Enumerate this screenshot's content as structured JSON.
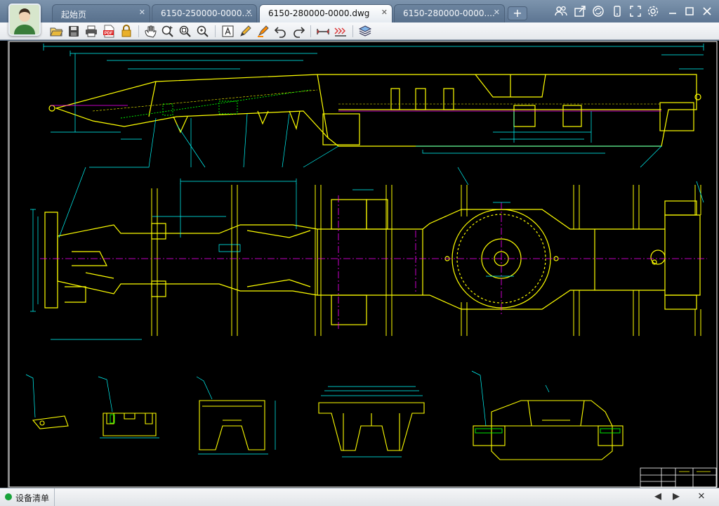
{
  "tabs": [
    {
      "label": "起始页",
      "active": false
    },
    {
      "label": "6150-250000-0000....",
      "active": false
    },
    {
      "label": "6150-280000-0000.dwg",
      "active": true
    },
    {
      "label": "6150-280000-0000....",
      "active": false
    }
  ],
  "new_tab_label": "+",
  "title_icons": [
    "users-icon",
    "share-icon",
    "cloud-sync-icon",
    "phone-icon",
    "fullscreen-icon",
    "settings-icon",
    "minimize-icon",
    "maximize-icon",
    "close-icon"
  ],
  "toolbar_icons": [
    "open-icon",
    "save-icon",
    "print-icon",
    "pdf-icon",
    "lock-icon",
    "pan-icon",
    "zoom-in-icon",
    "zoom-window-icon",
    "zoom-extents-icon",
    "text-icon",
    "pencil-icon",
    "highlighter-icon",
    "undo-icon",
    "redo-icon",
    "measure-icon",
    "dimension-icon",
    "layers-icon"
  ],
  "statusbar": {
    "label": "设备清单",
    "prev_label": "◀",
    "next_label": "▶",
    "close_label": "✕"
  },
  "colors": {
    "canvas": "#000000",
    "yellow": "#ffff00",
    "cyan": "#00ffff",
    "magenta": "#ff00ff",
    "green": "#00ff00",
    "white": "#ffffff"
  }
}
